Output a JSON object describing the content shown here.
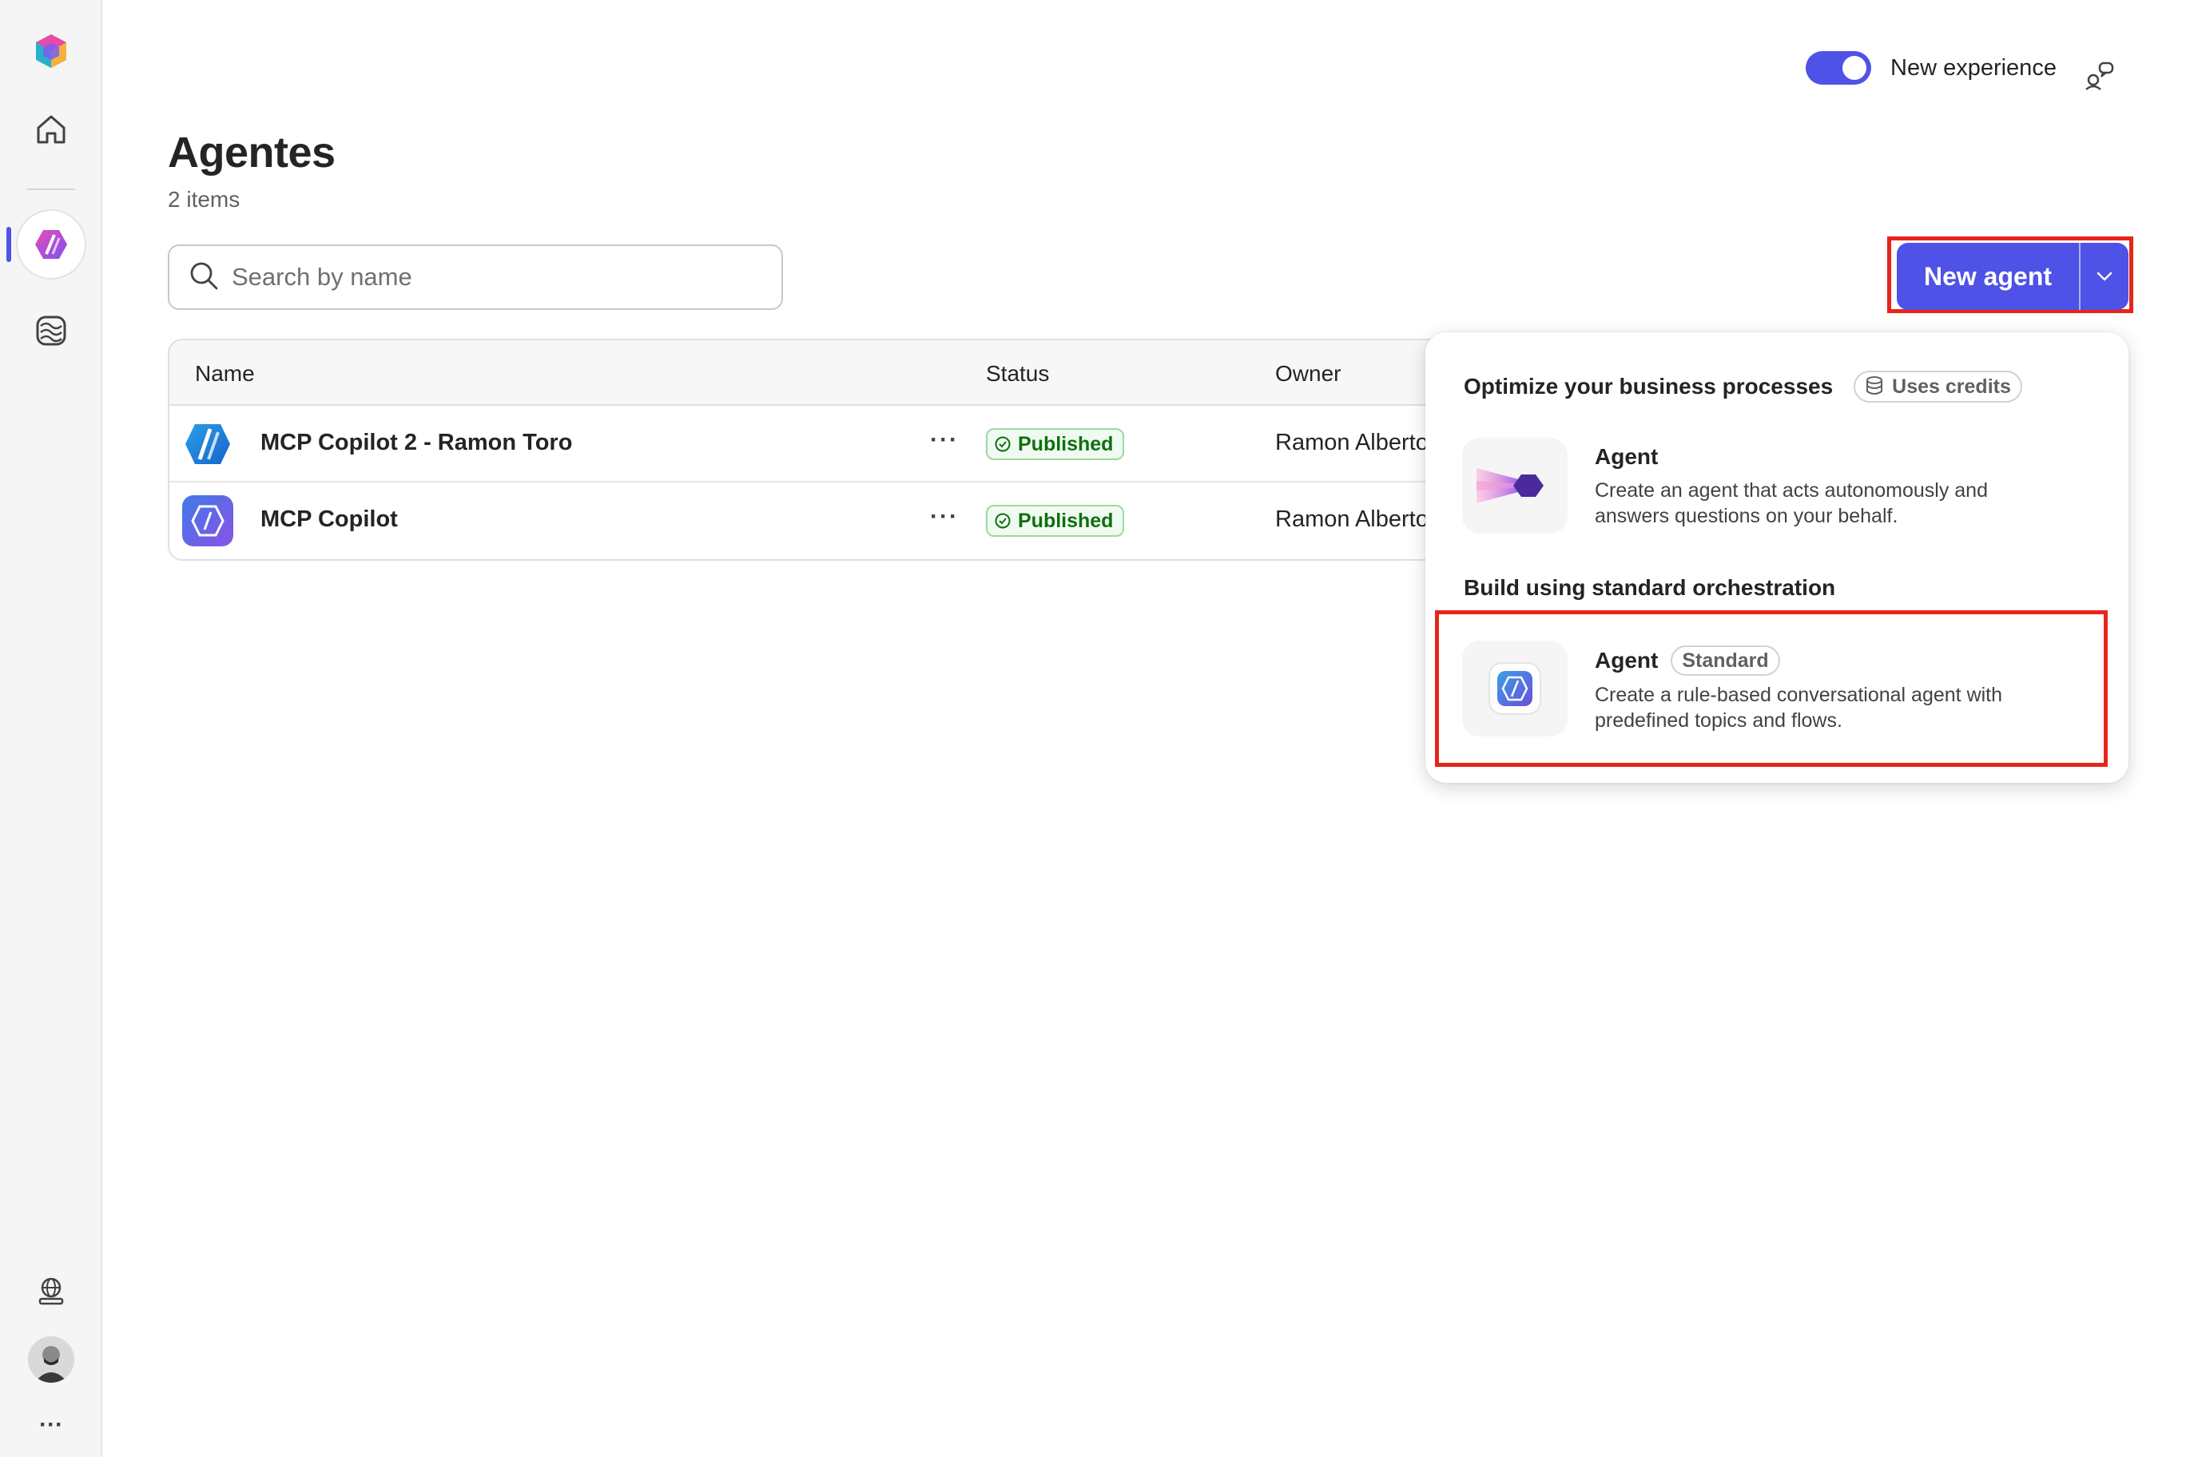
{
  "rail": {
    "items": [
      {
        "name": "copilot-logo-icon"
      },
      {
        "name": "home-icon"
      },
      {
        "name": "agents-icon"
      },
      {
        "name": "flows-icon"
      },
      {
        "name": "environment-icon"
      },
      {
        "name": "avatar"
      },
      {
        "name": "more-icon",
        "label": "···"
      }
    ]
  },
  "header": {
    "toggle_label": "New experience",
    "toggle_on": true
  },
  "page": {
    "title": "Agentes",
    "count": "2 items"
  },
  "search": {
    "placeholder": "Search by name",
    "value": ""
  },
  "new_agent": {
    "label": "New agent"
  },
  "table": {
    "columns": {
      "name": "Name",
      "status": "Status",
      "owner": "Owner"
    },
    "rows": [
      {
        "name": "MCP Copilot 2 - Ramon Toro",
        "more": "···",
        "status": "Published",
        "owner": "Ramon Alberto"
      },
      {
        "name": "MCP Copilot",
        "more": "···",
        "status": "Published",
        "owner": "Ramon Alberto"
      }
    ]
  },
  "menu": {
    "section1": {
      "title": "Optimize your business processes",
      "pill": "Uses credits",
      "option": {
        "title": "Agent",
        "description": "Create an agent that acts autonomously and answers questions on your behalf."
      }
    },
    "section2": {
      "title": "Build using standard orchestration",
      "option": {
        "title": "Agent",
        "pill": "Standard",
        "description": "Create a rule-based conversational agent with predefined topics and flows."
      }
    }
  },
  "colors": {
    "accent": "#4f52e6",
    "highlight": "#e8251a",
    "published_text": "#0e700e",
    "published_border": "#9fd89f"
  }
}
